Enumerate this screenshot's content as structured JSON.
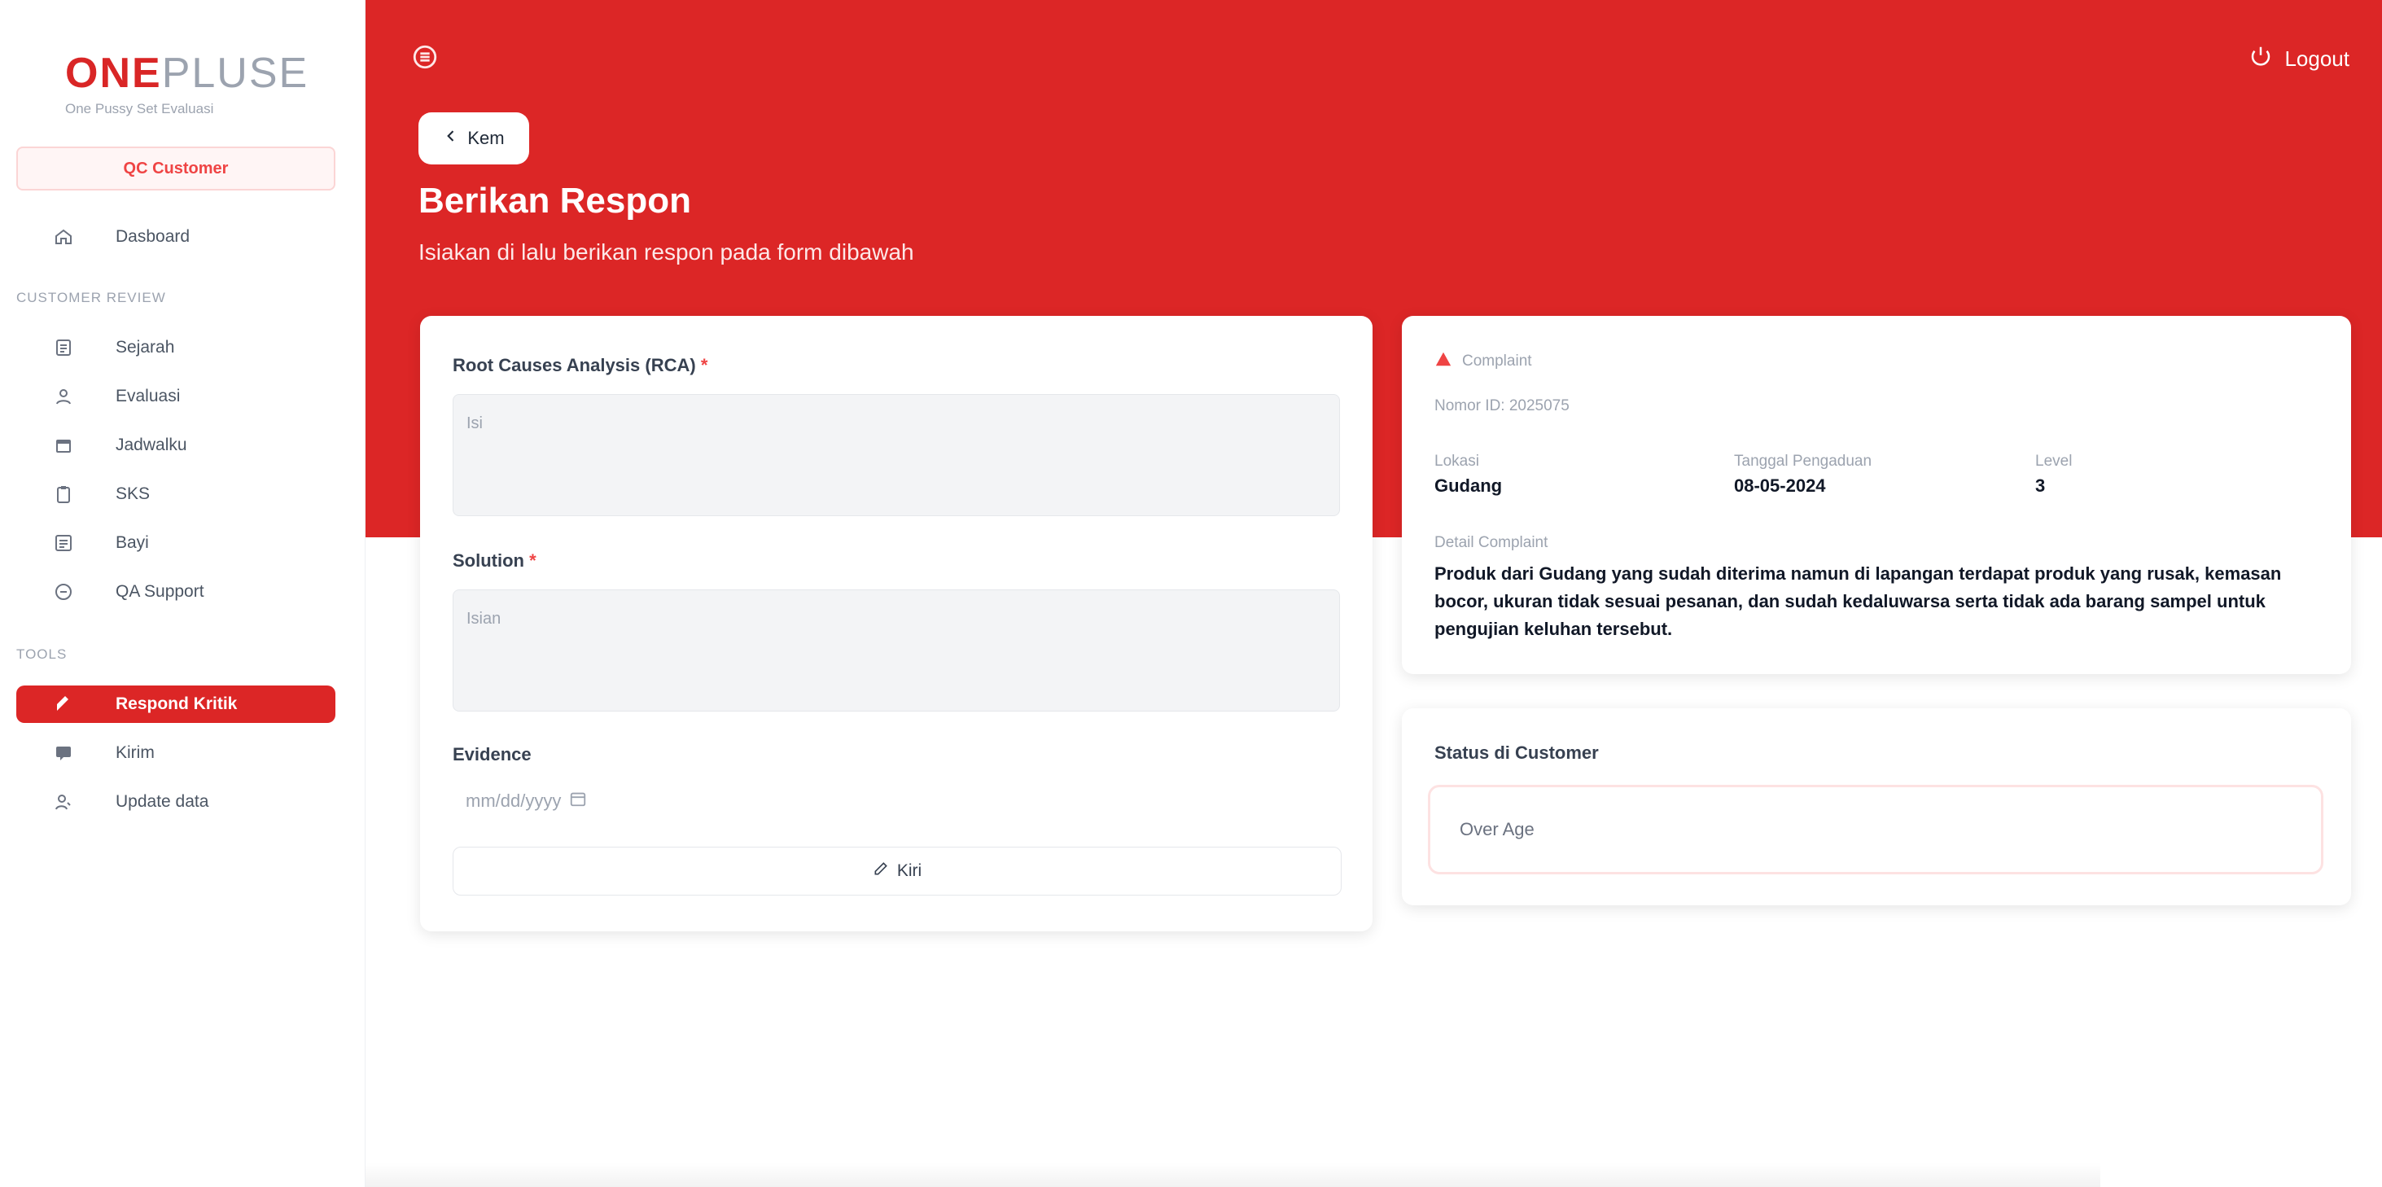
{
  "sidebar": {
    "brand": {
      "one": "ONE",
      "plus": "PLUSE",
      "tagline": "One Pussy Set Evaluasi"
    },
    "role_pill": "QC Customer",
    "dashboard": "Dasboard",
    "section_complaint": "Customer review",
    "items": [
      {
        "label": "Sejarah",
        "icon": "document-icon"
      },
      {
        "label": "Evaluasi",
        "icon": "user-icon"
      },
      {
        "label": "Jadwalku",
        "icon": "calendar-icon"
      },
      {
        "label": "SKS",
        "icon": "clipboard-icon"
      },
      {
        "label": "Bayi",
        "icon": "list-icon"
      },
      {
        "label": "QA Support",
        "icon": "support-icon"
      }
    ],
    "section_tools": "Tools",
    "tools": [
      {
        "label": "Respond Kritik",
        "icon": "reply-icon",
        "active": true
      },
      {
        "label": "Kirim",
        "icon": "chat-icon",
        "active": false
      },
      {
        "label": "Update data",
        "icon": "user-edit-icon",
        "active": false
      }
    ]
  },
  "header": {
    "logout_label": "Logout",
    "back_label": "Kem",
    "title": "Berikan Respon",
    "subtitle": "Isiakan di lalu berikan respon pada form dibawah"
  },
  "form": {
    "rca_label": "Root Causes Analysis (RCA)",
    "rca_placeholder": "Isi",
    "solution_label": "Solution",
    "solution_placeholder": "Isian",
    "evidence_label": "Evidence",
    "date_placeholder": "mm/dd/yyyy",
    "save_label": "Kiri"
  },
  "complaint": {
    "header_label": "Complaint",
    "id_text": "Nomor ID: 2025075",
    "col1_label": "Lokasi",
    "col1_value": "Gudang",
    "col2_label": "Tanggal Pengaduan",
    "col2_value": "08-05-2024",
    "col3_label": "Level",
    "col3_value": "3",
    "desc_label": "Detail Complaint",
    "desc": "Produk dari Gudang yang sudah diterima namun di lapangan terdapat produk yang rusak, kemasan bocor, ukuran tidak sesuai pesanan, dan sudah kedaluwarsa serta tidak ada barang sampel untuk pengujian keluhan tersebut."
  },
  "history": {
    "title": "Status di Customer",
    "field_text": "Over Age"
  },
  "colors": {
    "brand_red": "#dc2626",
    "page_bg": "#ffffff"
  }
}
